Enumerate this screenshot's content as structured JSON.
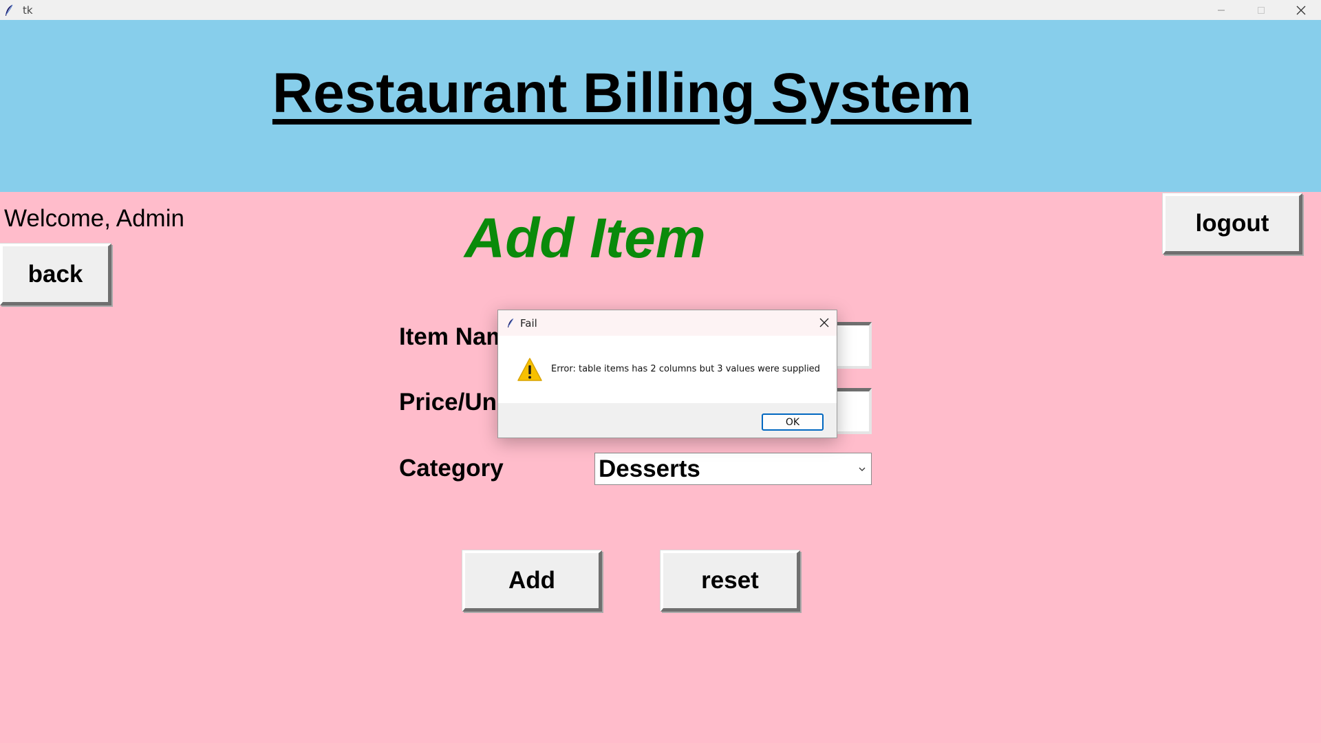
{
  "window": {
    "title": "tk"
  },
  "header": {
    "title": "Restaurant Billing System"
  },
  "welcome_text": "Welcome, Admin",
  "page_title": "Add Item",
  "buttons": {
    "back": "back",
    "logout": "logout",
    "add": "Add",
    "reset": "reset"
  },
  "form": {
    "item_name_label": "Item Name",
    "price_label": "Price/Unit",
    "category_label": "Category",
    "category_value": "Desserts"
  },
  "dialog": {
    "title": "Fail",
    "message": "Error: table items has 2 columns but 3 values were supplied",
    "ok_label": "OK"
  },
  "colors": {
    "header_bg": "#87ceeb",
    "body_bg": "#ffbccb",
    "heading_green": "#0a8a0a",
    "ok_button_border": "#0067c0"
  }
}
